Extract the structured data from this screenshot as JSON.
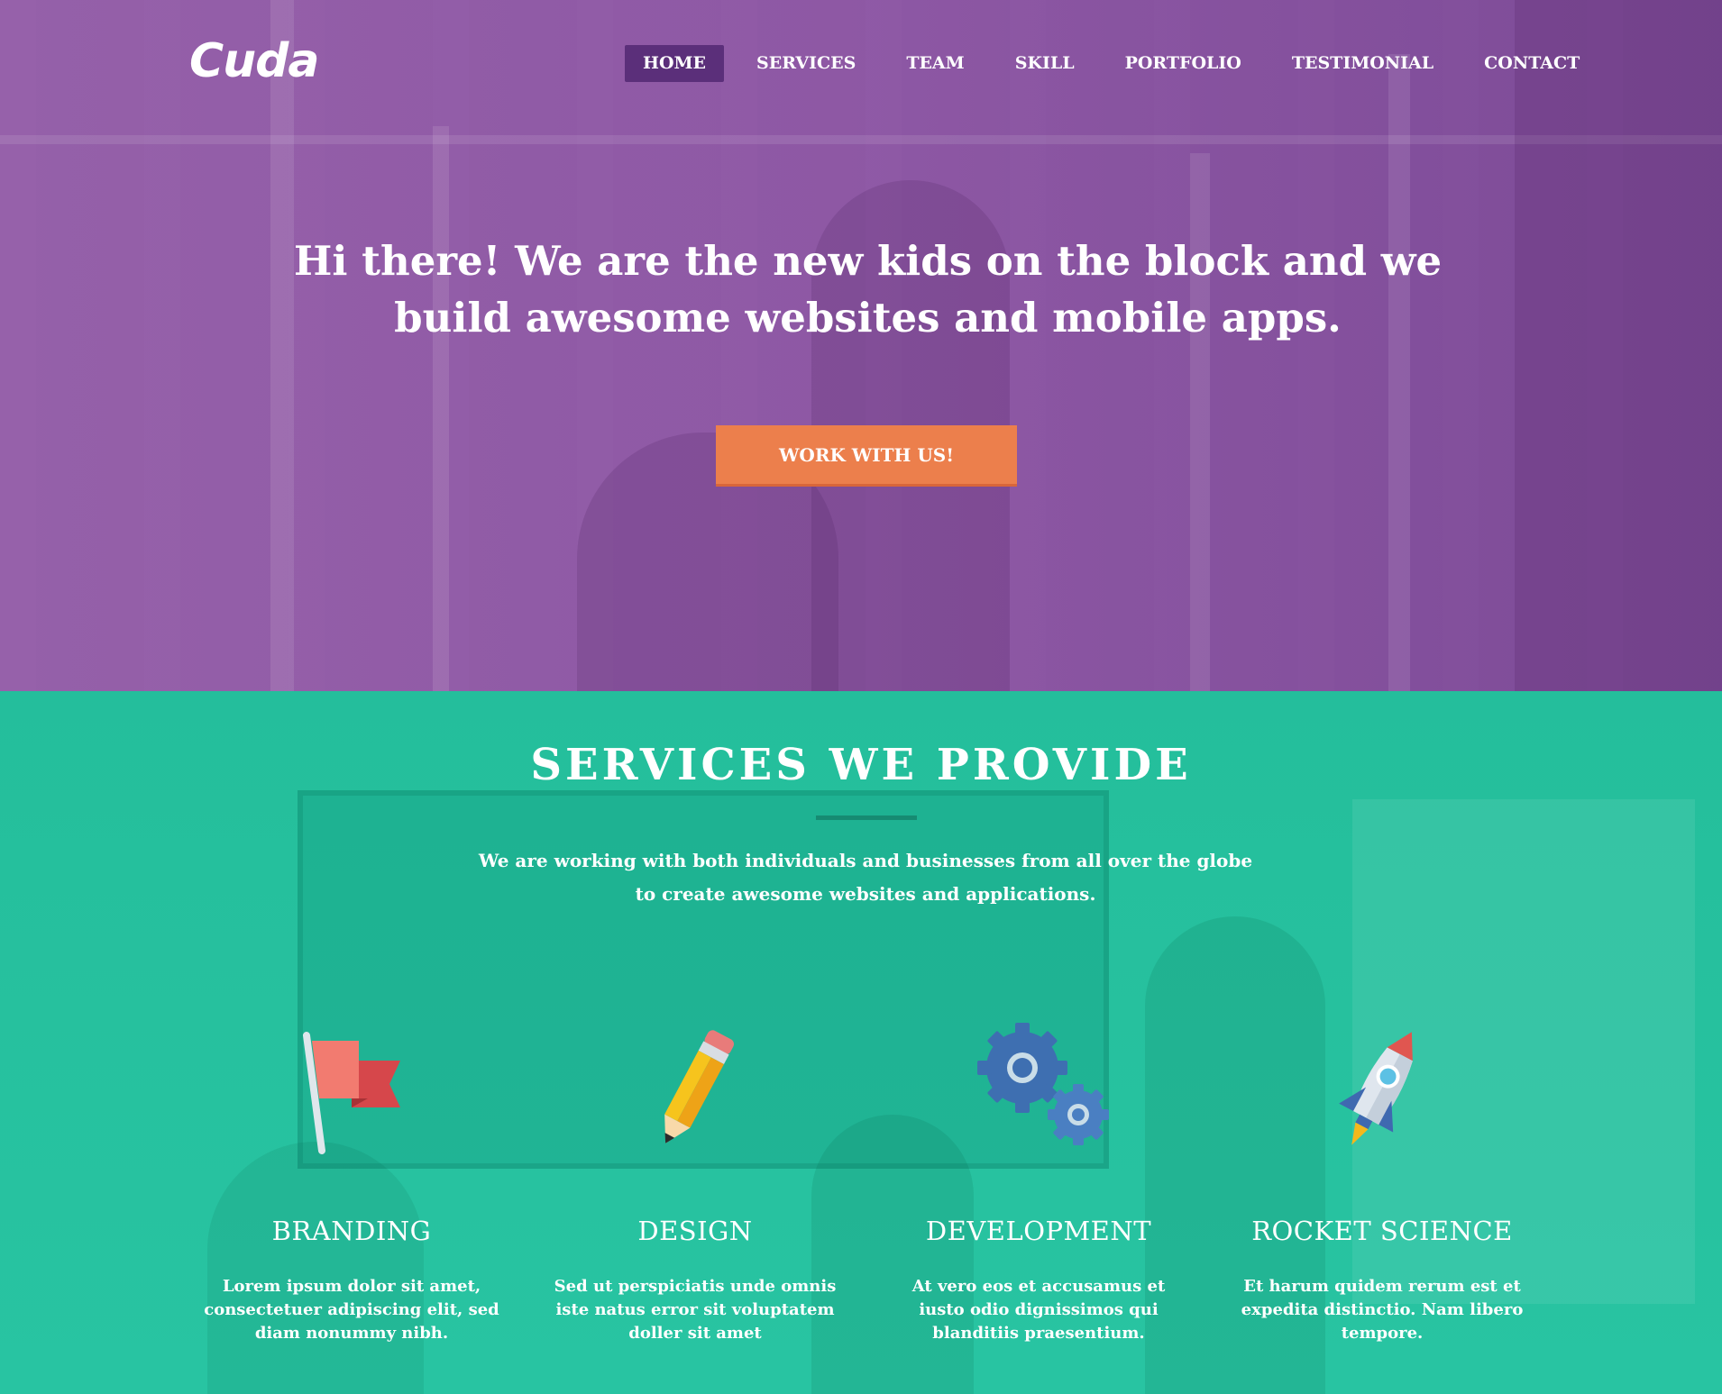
{
  "header": {
    "logo": "Cuda",
    "nav": [
      {
        "label": "HOME",
        "active": true
      },
      {
        "label": "SERVICES",
        "active": false
      },
      {
        "label": "TEAM",
        "active": false
      },
      {
        "label": "SKILL",
        "active": false
      },
      {
        "label": "PORTFOLIO",
        "active": false
      },
      {
        "label": "TESTIMONIAL",
        "active": false
      },
      {
        "label": "CONTACT",
        "active": false
      }
    ]
  },
  "hero": {
    "title": "Hi there! We are the new kids on the block and we build awesome websites and mobile apps.",
    "cta_label": "WORK WITH US!"
  },
  "services": {
    "title": "SERVICES WE PROVIDE",
    "subtitle": "We are working with both individuals and businesses from all over the globe to create awesome websites and applications.",
    "items": [
      {
        "icon": "flag-icon",
        "title": "BRANDING",
        "desc": "Lorem ipsum dolor sit amet, consectetuer adipiscing elit, sed diam nonummy nibh."
      },
      {
        "icon": "pencil-icon",
        "title": "DESIGN",
        "desc": "Sed ut perspiciatis unde omnis iste natus error sit voluptatem doller sit amet"
      },
      {
        "icon": "gears-icon",
        "title": "DEVELOPMENT",
        "desc": "At vero eos et accusamus et iusto odio dignissimos qui blanditiis praesentium."
      },
      {
        "icon": "rocket-icon",
        "title": "ROCKET SCIENCE",
        "desc": "Et harum quidem rerum est et expedita distinctio. Nam libero tempore."
      }
    ]
  },
  "colors": {
    "hero_overlay": "#8f5aa6",
    "nav_active": "#5b2f7a",
    "cta": "#ec7f4c",
    "services_bg": "#27c3a1",
    "divider": "#168b72"
  }
}
